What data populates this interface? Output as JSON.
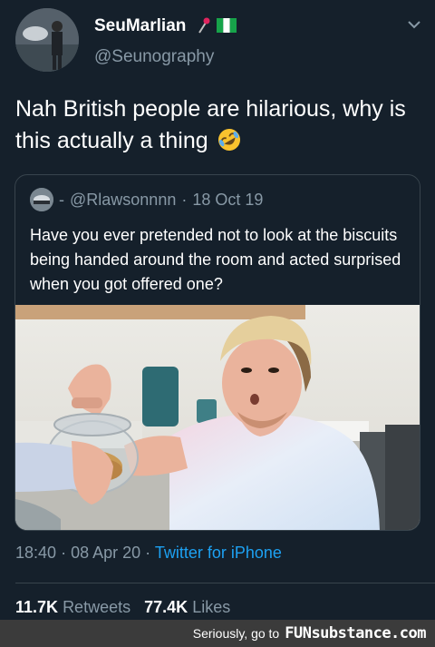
{
  "author": {
    "display_name": "SeuMarlian",
    "handle": "@Seunography",
    "flag_icons": [
      "microphone-emoji-icon",
      "nigeria-flag-icon"
    ]
  },
  "tweet": {
    "text": "Nah British people are hilarious, why is this actually a thing",
    "emoji": "rolling-on-floor-laughing-emoji-icon"
  },
  "quoted": {
    "separator": "-",
    "handle": "@Rlawsonnnn",
    "dot": "·",
    "date": "18 Oct 19",
    "text": "Have you ever pretended not to look at the biscuits being handed around the room and acted surprised when you got offered one?"
  },
  "meta": {
    "time": "18:40",
    "dot1": "·",
    "date": "08 Apr 20",
    "dot2": "·",
    "source": "Twitter for iPhone"
  },
  "stats": {
    "retweets_count": "11.7K",
    "retweets_label": "Retweets",
    "likes_count": "77.4K",
    "likes_label": "Likes"
  },
  "watermark": {
    "text": "Seriously, go to",
    "logo": "FUNsubstance.com"
  },
  "colors": {
    "background": "#15202b",
    "secondary_text": "#8899a6",
    "link": "#1da1f2",
    "border": "#38444d"
  }
}
